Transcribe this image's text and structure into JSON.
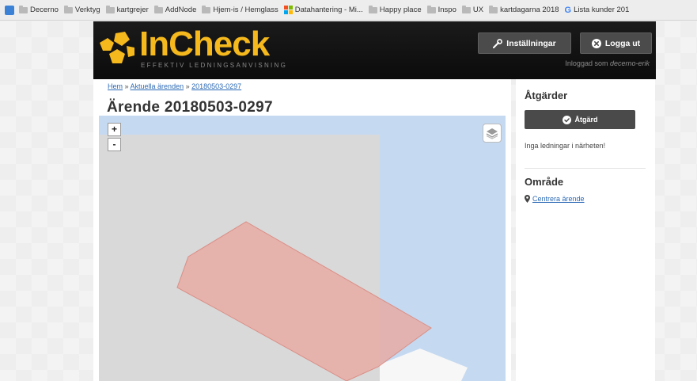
{
  "bookmarks": [
    {
      "label": "Decerno",
      "icon": "extension-icon"
    },
    {
      "label": "Verktyg",
      "icon": "folder-icon"
    },
    {
      "label": "kartgrejer",
      "icon": "folder-icon"
    },
    {
      "label": "AddNode",
      "icon": "folder-icon"
    },
    {
      "label": "Hjem-is / Hemglass",
      "icon": "folder-icon"
    },
    {
      "label": "Datahantering - Mi...",
      "icon": "microsoft-icon"
    },
    {
      "label": "Happy place",
      "icon": "folder-icon"
    },
    {
      "label": "Inspo",
      "icon": "folder-icon"
    },
    {
      "label": "UX",
      "icon": "folder-icon"
    },
    {
      "label": "kartdagarna 2018",
      "icon": "folder-icon"
    },
    {
      "label": "Lista kunder 201",
      "icon": "google-icon"
    }
  ],
  "header": {
    "logo_text": "InCheck",
    "tagline": "EFFEKTIV LEDNINGSANVISNING",
    "settings_label": "Inställningar",
    "logout_label": "Logga ut",
    "logged_in_prefix": "Inloggad som ",
    "logged_in_user": "decerno-erik",
    "brand_color": "#f5b81d"
  },
  "breadcrumb": {
    "home": "Hem",
    "sep1": " » ",
    "current_cases": "Aktuella ärenden",
    "sep2": " » ",
    "case": "20180503-0297"
  },
  "page_title": "Ärende 20180503-0297",
  "map": {
    "zoom_in": "+",
    "zoom_out": "-",
    "layers_icon": "layers-icon",
    "water_color": "#c5d9f1",
    "land_color": "#d9d9d9",
    "polygon_color": "#e8a8a0"
  },
  "sidebar": {
    "actions_title": "Åtgärder",
    "action_button": "Åtgärd",
    "no_lines": "Inga ledningar i närheten!",
    "area_title": "Område",
    "center_link": "Centrera ärende"
  }
}
